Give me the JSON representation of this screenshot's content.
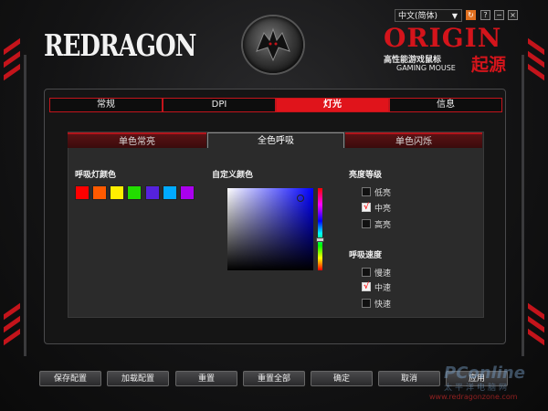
{
  "brand": {
    "left_logo": "REDRAGON",
    "right_logo": "ORIGIN",
    "right_sub_cn": "高性能游戏鼠标",
    "right_sub_en": "GAMING MOUSE",
    "right_big_cn": "起源"
  },
  "window": {
    "language": "中文(简体)",
    "help_label": "?",
    "min_label": "−",
    "close_label": "×"
  },
  "tabs": [
    {
      "label": "常规",
      "active": false
    },
    {
      "label": "DPI",
      "active": false
    },
    {
      "label": "灯光",
      "active": true
    },
    {
      "label": "信息",
      "active": false
    }
  ],
  "subtabs": [
    {
      "label": "单色常亮",
      "active": false
    },
    {
      "label": "全色呼吸",
      "active": true
    },
    {
      "label": "单色闪烁",
      "active": false
    }
  ],
  "breathing_colors": {
    "label": "呼吸灯颜色",
    "swatches": [
      "#ff0000",
      "#ff5a00",
      "#ffee00",
      "#22dd00",
      "#5522dd",
      "#00aaff",
      "#aa00ee"
    ]
  },
  "custom_color": {
    "label": "自定义颜色"
  },
  "brightness": {
    "label": "亮度等级",
    "options": [
      {
        "label": "低亮",
        "checked": false
      },
      {
        "label": "中亮",
        "checked": true
      },
      {
        "label": "高亮",
        "checked": false
      }
    ]
  },
  "speed": {
    "label": "呼吸速度",
    "options": [
      {
        "label": "慢速",
        "checked": false
      },
      {
        "label": "中速",
        "checked": true
      },
      {
        "label": "快速",
        "checked": false
      }
    ]
  },
  "check_mark": "√",
  "buttons": {
    "save": "保存配置",
    "load": "加载配置",
    "reset": "重置",
    "reset_all": "重置全部",
    "ok": "确定",
    "cancel": "取消",
    "apply": "应用"
  },
  "watermark": {
    "text": "PConline",
    "cn": "太平洋电脑网",
    "url": "www.redragonzone.com"
  }
}
